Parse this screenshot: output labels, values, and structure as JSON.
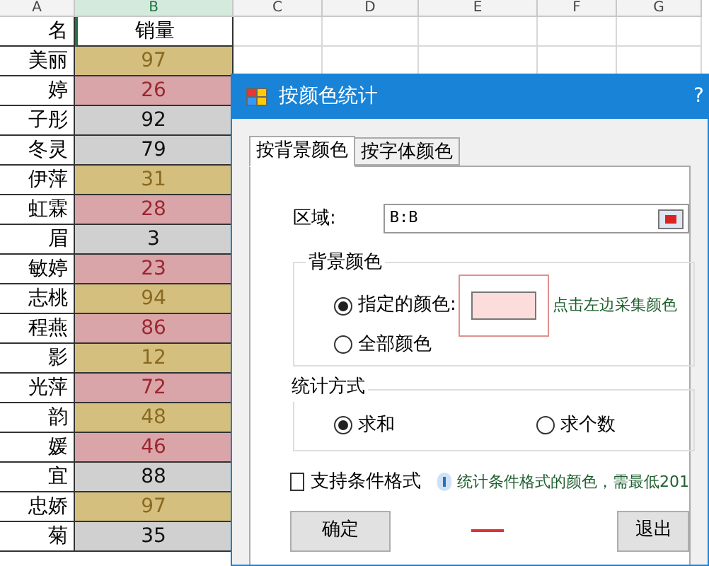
{
  "sheet": {
    "columns": [
      "A",
      "B",
      "C",
      "D",
      "E",
      "F",
      "G"
    ],
    "header": {
      "name": "名",
      "value": "销量"
    },
    "rows": [
      {
        "name": "美丽",
        "value": "97",
        "color": "#d5bf7f"
      },
      {
        "name": "婷",
        "value": "26",
        "color": "#d9a5a8"
      },
      {
        "name": "子彤",
        "value": "92",
        "color": "#d0d0d0"
      },
      {
        "name": "冬灵",
        "value": "79",
        "color": "#d0d0d0"
      },
      {
        "name": "伊萍",
        "value": "31",
        "color": "#d5bf7f"
      },
      {
        "name": "虹霖",
        "value": "28",
        "color": "#d9a5a8"
      },
      {
        "name": "眉",
        "value": "3",
        "color": "#d0d0d0"
      },
      {
        "name": "敏婷",
        "value": "23",
        "color": "#d9a5a8"
      },
      {
        "name": "志桃",
        "value": "94",
        "color": "#d5bf7f"
      },
      {
        "name": "程燕",
        "value": "86",
        "color": "#d9a5a8"
      },
      {
        "name": "影",
        "value": "12",
        "color": "#d5bf7f"
      },
      {
        "name": "光萍",
        "value": "72",
        "color": "#d9a5a8"
      },
      {
        "name": "韵",
        "value": "48",
        "color": "#d5bf7f"
      },
      {
        "name": "媛",
        "value": "46",
        "color": "#d9a5a8"
      },
      {
        "name": "宜",
        "value": "88",
        "color": "#d0d0d0"
      },
      {
        "name": "忠娇",
        "value": "97",
        "color": "#d5bf7f"
      },
      {
        "name": "菊",
        "value": "35",
        "color": "#d0d0d0"
      }
    ]
  },
  "dialog": {
    "title": "按颜色统计",
    "help": "?",
    "tabs": [
      {
        "label": "按背景颜色",
        "selected": true
      },
      {
        "label": "按字体颜色",
        "selected": false
      }
    ],
    "range": {
      "label": "区域:",
      "value": "B:B"
    },
    "background_group": {
      "legend": "背景颜色",
      "options": [
        {
          "label": "指定的颜色:",
          "selected": true
        },
        {
          "label": "全部颜色",
          "selected": false
        }
      ],
      "hint": "点击左边采集颜色"
    },
    "method_group": {
      "legend": "统计方式",
      "options": [
        {
          "label": "求和",
          "selected": true
        },
        {
          "label": "求个数",
          "selected": false
        }
      ]
    },
    "conditional": {
      "label": "支持条件格式",
      "checked": false
    },
    "info": "统计条件格式的颜色，需最低201",
    "buttons": [
      "确定",
      "退出"
    ]
  }
}
